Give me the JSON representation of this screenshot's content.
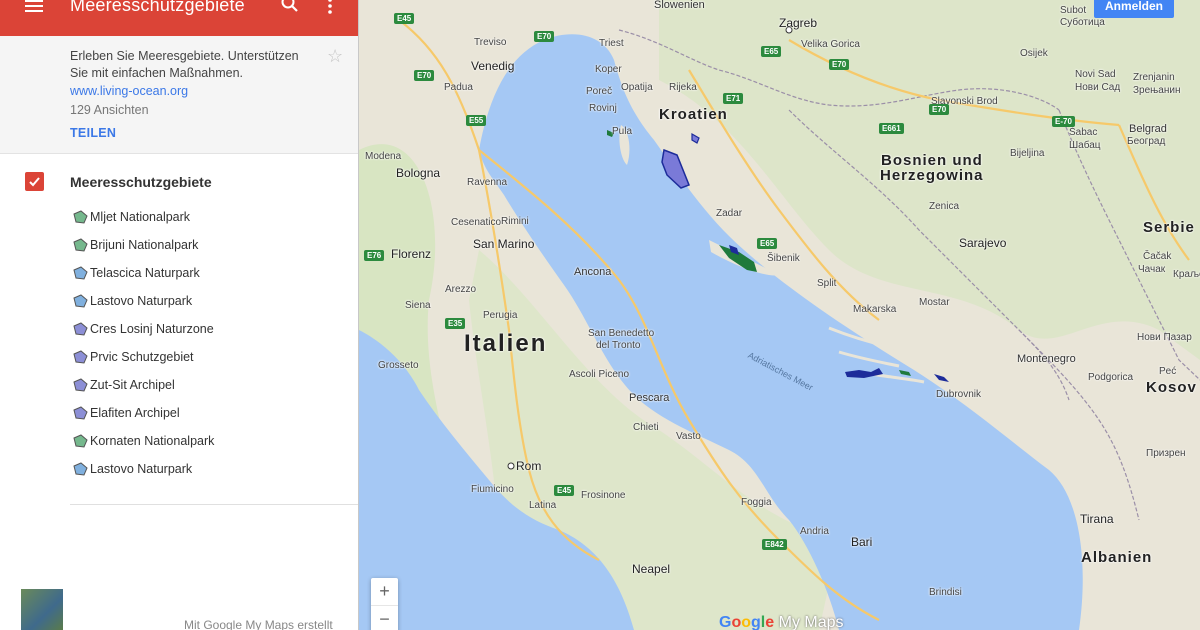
{
  "app": {
    "title": "Meeresschutzgebiete",
    "icons": [
      "menu-icon",
      "search-icon",
      "more-vert-icon",
      "star-icon",
      "check-icon"
    ]
  },
  "about": {
    "description": "Erleben Sie Meeresgebiete. Unterstützen Sie mit einfachen Maßnahmen.",
    "link": "www.living-ocean.org",
    "views": "129 Ansichten",
    "share": "TEILEN"
  },
  "layer": {
    "title": "Meeresschutzgebiete",
    "checked": true,
    "items": [
      {
        "label": "Mljet Nationalpark",
        "color": "#3a9a5c"
      },
      {
        "label": "Brijuni Nationalpark",
        "color": "#3a9a5c"
      },
      {
        "label": "Telascica Naturpark",
        "color": "#4a8fd0"
      },
      {
        "label": "Lastovo Naturpark",
        "color": "#4a8fd0"
      },
      {
        "label": "Cres Losinj Naturzone",
        "color": "#5b5fc4"
      },
      {
        "label": "Prvic Schutzgebiet",
        "color": "#5b5fc4"
      },
      {
        "label": "Zut-Sit Archipel",
        "color": "#5b5fc4"
      },
      {
        "label": "Elafiten Archipel",
        "color": "#5b5fc4"
      },
      {
        "label": "Kornaten Nationalpark",
        "color": "#3a9a5c"
      },
      {
        "label": "Lastovo Naturpark",
        "color": "#4a8fd0"
      }
    ]
  },
  "footer": {
    "made_with": "Mit Google My Maps erstellt"
  },
  "map": {
    "signin": "Anmelden",
    "zoom_in": "+",
    "zoom_out": "−",
    "google_logo": "Google",
    "my_maps_logo": "My Maps",
    "colors": {
      "water": "#a5c8f4",
      "land": "#e9e5d8",
      "forest": "#cde2b5",
      "green_area": "#1f7a3c",
      "blue_area": "#1d2c9a",
      "lilac_area": "#7a7ad8"
    },
    "labels": {
      "slowenien": "Slowenien",
      "zagreb": "Zagreb",
      "velika_gorica": "Velika Gorica",
      "treviso": "Treviso",
      "triest": "Triest",
      "venedig": "Venedig",
      "padua": "Padua",
      "koper": "Koper",
      "opatija": "Opatija",
      "rijeka": "Rijeka",
      "porec": "Poreč",
      "rovinj": "Rovinj",
      "pula": "Pula",
      "kroatien": "Kroatien",
      "osijek": "Osijek",
      "slavonski_brod": "Slavonski Brod",
      "novi_sad": "Novi Sad",
      "novi_sad_cyr": "Нови Сад",
      "zrenjanin": "Zrenjanin",
      "zrenjanin_cyr": "Зрењанин",
      "sabac": "Šabac",
      "sabac_cyr": "Шабац",
      "beograd": "Belgrad",
      "beograd_cyr": "Београд",
      "bijeljina": "Bijeljina",
      "bosnien": "Bosnien und",
      "herzegowina": "Herzegowina",
      "modena": "Modena",
      "bologna": "Bologna",
      "ravenna": "Ravenna",
      "cesenatico": "Cesenatico",
      "rimini": "Rimini",
      "san_marino": "San Marino",
      "florenz": "Florenz",
      "arezzo": "Arezzo",
      "siena": "Siena",
      "perugia": "Perugia",
      "ancona": "Ancona",
      "zadar": "Zadar",
      "sibenik": "Šibenik",
      "split": "Split",
      "zenica": "Zenica",
      "sarajevo": "Sarajevo",
      "serbien": "Serbie",
      "cacak": "Čačak",
      "cacak_cyr": "Чачак",
      "kraljevo": "Краље",
      "novi_pazar": "Нови Пазар",
      "italien": "Italien",
      "san_benedetto": "San Benedetto",
      "del_tronto": "del Tronto",
      "ascoli": "Ascoli Piceno",
      "grosseto": "Grosseto",
      "makarska": "Makarska",
      "mostar": "Mostar",
      "montenegro": "Montenegro",
      "podgorica": "Podgorica",
      "kosovo": "Kosov",
      "prizren": "Призрен",
      "dubrovnik": "Dubrovnik",
      "adriatisches_meer": "Adriatisches Meer",
      "pescara": "Pescara",
      "chieti": "Chieti",
      "vasto": "Vasto",
      "rom": "Rom",
      "fiumicino": "Fiumicino",
      "frosinone": "Frosinone",
      "latina": "Latina",
      "foggia": "Foggia",
      "andria": "Andria",
      "bari": "Bari",
      "tirana": "Tirana",
      "albanien": "Albanien",
      "neapel": "Neapel",
      "brindisi": "Brindisi",
      "pec": "Peć",
      "subotica": "Subot",
      "subotica_cyr": "Суботица"
    },
    "roads": [
      "E45",
      "E70",
      "E55",
      "E65",
      "E71",
      "E661",
      "E76",
      "E35",
      "E842",
      "E-70"
    ]
  }
}
